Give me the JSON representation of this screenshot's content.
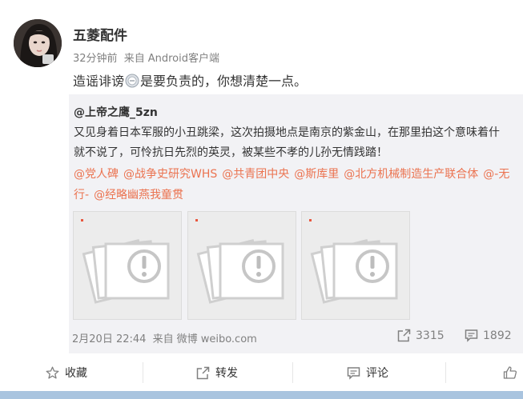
{
  "post": {
    "username": "五菱配件",
    "time": "32分钟前",
    "source_prefix": "来自",
    "source": "Android客户端",
    "text_before": "造谣诽谤",
    "text_after": "是要负责的，你想清楚一点。"
  },
  "repost": {
    "username": "@上帝之鹰_5zn",
    "text_line1": "又见身着日本军服的小丑跳梁，这次拍摄地点是南京的紫金山，在那里拍这个意味着什",
    "text_line2": "就不说了，可怜抗日先烈的英灵，被某些不孝的儿孙无情践踏！",
    "mentions": [
      "@党人碑",
      "@战争史研究WHS",
      "@共青团中央",
      "@斯库里",
      "@北方机械制造生产联合体",
      "@-无",
      "行-",
      "@经略幽燕我童贯"
    ],
    "time": "2月20日 22:44",
    "source_prefix": "来自",
    "source": "微博 weibo.com",
    "repost_count": "3315",
    "comment_count": "1892"
  },
  "actions": {
    "favorite": "收藏",
    "repost": "转发",
    "comment": "评论"
  },
  "colors": {
    "mention": "#eb7350",
    "meta": "#808080",
    "repost_bg": "#f2f2f5"
  },
  "icons": [
    "star-icon",
    "repost-icon",
    "comment-icon",
    "thumbs-up-icon",
    "error-image-icon",
    "emoticon-icon"
  ]
}
